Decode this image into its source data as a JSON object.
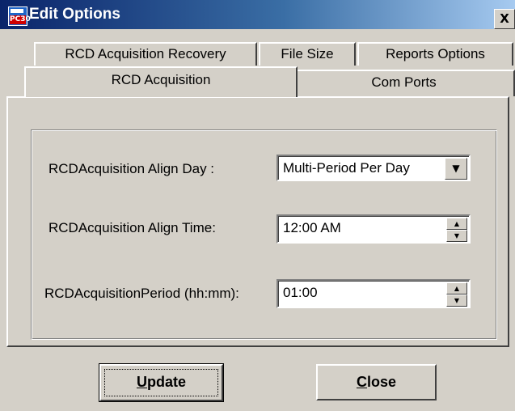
{
  "window": {
    "title": "Edit Options",
    "app_icon_badge": "PC30",
    "close_glyph": "X"
  },
  "tabs": {
    "back_row": [
      {
        "label": "RCD Acquisition Recovery"
      },
      {
        "label": "File Size"
      },
      {
        "label": "Reports Options"
      }
    ],
    "front_row": [
      {
        "label": "RCD Acquisition",
        "selected": true
      },
      {
        "label": "Com Ports",
        "selected": false
      }
    ]
  },
  "form": {
    "align_day": {
      "label": "RCDAcquisition Align Day :",
      "value": "Multi-Period Per Day"
    },
    "align_time": {
      "label": "RCDAcquisition Align Time:",
      "value": "12:00 AM"
    },
    "period": {
      "label": "RCDAcquisitionPeriod (hh:mm):",
      "value": "01:00"
    }
  },
  "buttons": {
    "update": {
      "mnemonic": "U",
      "rest": "pdate"
    },
    "close": {
      "mnemonic": "C",
      "rest": "lose"
    }
  },
  "icons": {
    "dropdown": "▼",
    "spin_up": "▲",
    "spin_down": "▼"
  }
}
